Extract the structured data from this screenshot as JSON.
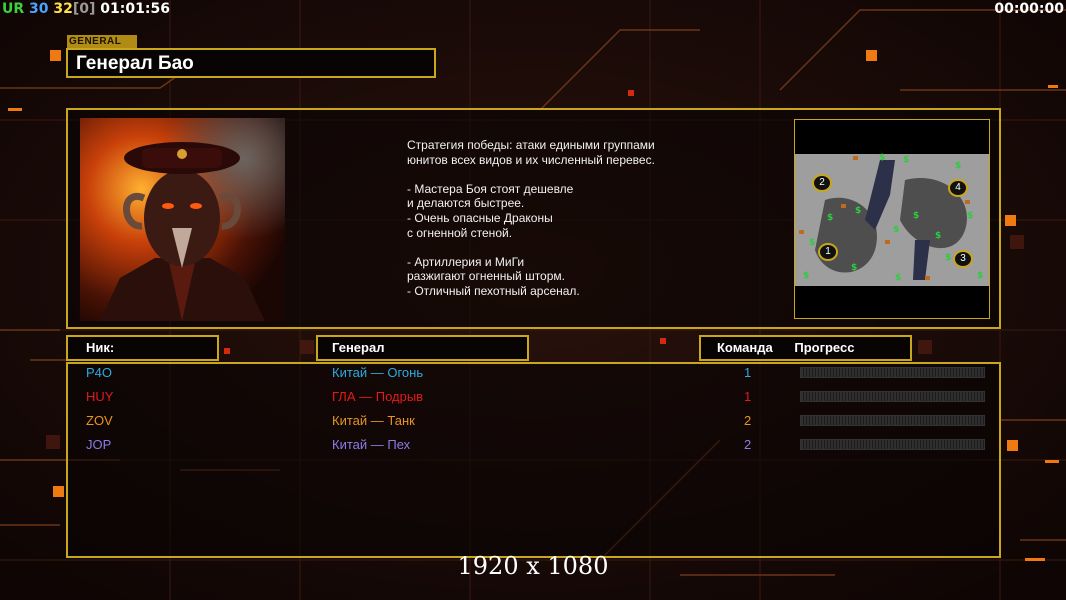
{
  "hud": {
    "ur_label": "UR",
    "num1": "30",
    "num2": "32",
    "bracket": "[0]",
    "time": "01:01:56",
    "timer_right": "00:00:00"
  },
  "header": {
    "tag": "GENERAL",
    "title": "Генерал Бао"
  },
  "description": "Стратегия победы: атаки едиными группами\nюнитов всех видов и их численный перевес.\n\n- Мастера Боя стоят дешевле\nи делаются быстрее.\n- Очень опасные Драконы\nс огненной стеной.\n\n- Артиллерия и МиГи\nразжигают огненный шторм.\n- Отличный пехотный арсенал.",
  "minimap": {
    "start_positions": [
      "1",
      "2",
      "3",
      "4"
    ]
  },
  "columns": {
    "nick": "Ник:",
    "general": "Генерал",
    "team": "Команда",
    "progress": "Прогресс"
  },
  "players": [
    {
      "nick": "P4O",
      "general": "Китай — Огонь",
      "team": "1",
      "color": "#2fa9e0",
      "progress": 0
    },
    {
      "nick": "HUY",
      "general": "ГЛА — Подрыв",
      "team": "1",
      "color": "#e21a1a",
      "progress": 0
    },
    {
      "nick": "ZOV",
      "general": "Китай — Танк",
      "team": "2",
      "color": "#e7951f",
      "progress": 0
    },
    {
      "nick": "JOP",
      "general": "Китай — Пех",
      "team": "2",
      "color": "#8b7ce8",
      "progress": 0
    }
  ],
  "footer": "1920 x 1080",
  "colors": {
    "accent": "#c9a71a",
    "orange": "#f07a12",
    "background": "#160907"
  }
}
